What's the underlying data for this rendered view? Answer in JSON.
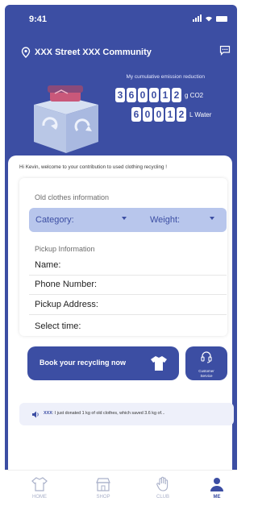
{
  "status": {
    "time": "9:41"
  },
  "header": {
    "location": "XXX Street XXX Community"
  },
  "emission": {
    "label": "My cumulative emission reduction",
    "co2_digits": [
      "3",
      "6",
      "0",
      "0",
      "1",
      "2"
    ],
    "co2_unit": "g CO2",
    "water_digits": [
      "6",
      "0",
      "0",
      "1",
      "2"
    ],
    "water_unit": "L Water"
  },
  "welcome": "Hi Kevin, welcome to your contribution to used clothing recycling !",
  "form": {
    "clothes_title": "Old clothes information",
    "category_label": "Category:",
    "weight_label": "Weight:",
    "pickup_title": "Pickup Information",
    "name_label": "Name:",
    "phone_label": "Phone Number:",
    "address_label": "Pickup Address:",
    "time_label": "Select time:"
  },
  "actions": {
    "book_label": "Book your recycling now",
    "service_line1": "Customer",
    "service_line2": "Service"
  },
  "ticker": {
    "user": "XXX",
    "message": ": I just donated 1 kg of old clothes, which saved 3.6 kg of..."
  },
  "tabs": [
    {
      "label": "HOME",
      "icon": "shirt-icon"
    },
    {
      "label": "SHOP",
      "icon": "store-icon"
    },
    {
      "label": "CLUB",
      "icon": "hand-icon"
    },
    {
      "label": "ME",
      "icon": "person-icon"
    }
  ],
  "colors": {
    "primary": "#3c4ea3",
    "pill": "#b8c6ec",
    "tab_inactive": "#a9b0c9"
  }
}
